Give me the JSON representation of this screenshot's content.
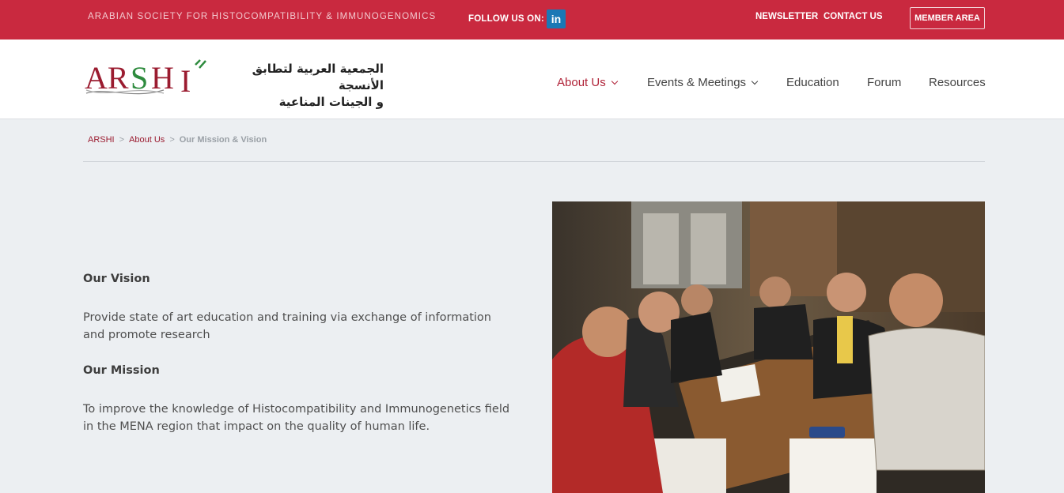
{
  "topbar": {
    "org_name": "ARABIAN SOCIETY FOR HISTOCOMPATIBILITY & IMMUNOGENOMICS",
    "follow_label": "FOLLOW US ON:",
    "linkedin_glyph": "in",
    "newsletter": "NEWSLETTER",
    "contact": "CONTACT US",
    "member_area": "MEMBER AREA",
    "color": "#c9293f"
  },
  "header": {
    "logo_text": "ARSHI",
    "arabic_line1": "الجمعية العربية لتطابق الأنسجة",
    "arabic_line2": "و الجينات المناعية",
    "nav": [
      {
        "label": "About Us",
        "dropdown": true,
        "active": true
      },
      {
        "label": "Events & Meetings",
        "dropdown": true,
        "active": false
      },
      {
        "label": "Education",
        "dropdown": false,
        "active": false
      },
      {
        "label": "Forum",
        "dropdown": false,
        "active": false
      },
      {
        "label": "Resources",
        "dropdown": false,
        "active": false
      }
    ]
  },
  "breadcrumb": {
    "home": "ARSHI",
    "parent": "About Us",
    "current": "Our Mission & Vision",
    "separator": ">"
  },
  "content": {
    "vision_title": "Our Vision",
    "vision_text": "Provide state of art education and training via exchange of information and promote research",
    "mission_title": "Our Mission",
    "mission_text": "To improve the knowledge of Histocompatibility and Immunogenetics field in the MENA region that impact on the quality of human life."
  },
  "colors": {
    "accent": "#b02338",
    "page_bg": "#eceff2",
    "logo_green": "#2e8b3e"
  }
}
